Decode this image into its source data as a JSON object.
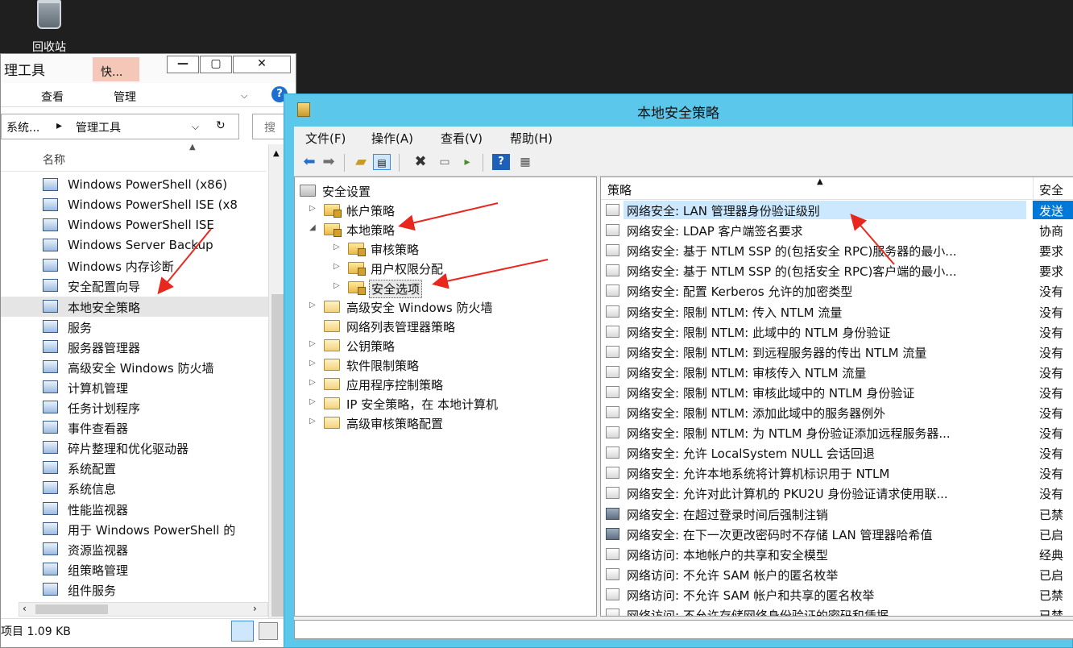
{
  "desktop": {
    "recycle_bin_label": "回收站"
  },
  "explorer": {
    "title": "理工具",
    "quick_tab": "快...",
    "min_btn": "—",
    "max_btn": "▢",
    "close_btn": "✕",
    "ribbon": {
      "view": "查看",
      "manage": "管理",
      "help": "?"
    },
    "address": {
      "root": "系统...",
      "sep": "▸",
      "current": "管理工具"
    },
    "search_placeholder": "搜",
    "column_name": "名称",
    "items": [
      "Windows PowerShell (x86)",
      "Windows PowerShell ISE (x8",
      "Windows PowerShell ISE",
      "Windows Server Backup",
      "Windows 内存诊断",
      "安全配置向导",
      "本地安全策略",
      "服务",
      "服务器管理器",
      "高级安全 Windows 防火墙",
      "计算机管理",
      "任务计划程序",
      "事件查看器",
      "碎片整理和优化驱动器",
      "系统配置",
      "系统信息",
      "性能监视器",
      "用于 Windows PowerShell 的",
      "资源监视器",
      "组策略管理",
      "组件服务"
    ],
    "selected_index": 6,
    "status": "项目 1.09 KB"
  },
  "secpol": {
    "title": "本地安全策略",
    "menu": [
      "文件(F)",
      "操作(A)",
      "查看(V)",
      "帮助(H)"
    ],
    "tree": [
      {
        "label": "安全设置",
        "level": 0,
        "arrow": "",
        "icon": "root"
      },
      {
        "label": "帐户策略",
        "level": 1,
        "arrow": "▷",
        "icon": "lock"
      },
      {
        "label": "本地策略",
        "level": 1,
        "arrow": "◢",
        "icon": "lock"
      },
      {
        "label": "审核策略",
        "level": 2,
        "arrow": "▷",
        "icon": "lock"
      },
      {
        "label": "用户权限分配",
        "level": 2,
        "arrow": "▷",
        "icon": "lock"
      },
      {
        "label": "安全选项",
        "level": 2,
        "arrow": "▷",
        "icon": "lock",
        "selected": true
      },
      {
        "label": "高级安全 Windows 防火墙",
        "level": 1,
        "arrow": "▷",
        "icon": "plain"
      },
      {
        "label": "网络列表管理器策略",
        "level": 1,
        "arrow": "",
        "icon": "plain"
      },
      {
        "label": "公钥策略",
        "level": 1,
        "arrow": "▷",
        "icon": "plain"
      },
      {
        "label": "软件限制策略",
        "level": 1,
        "arrow": "▷",
        "icon": "plain"
      },
      {
        "label": "应用程序控制策略",
        "level": 1,
        "arrow": "▷",
        "icon": "plain"
      },
      {
        "label": "IP 安全策略，在 本地计算机",
        "level": 1,
        "arrow": "▷",
        "icon": "plain"
      },
      {
        "label": "高级审核策略配置",
        "level": 1,
        "arrow": "▷",
        "icon": "plain"
      }
    ],
    "list_header": {
      "policy": "策略",
      "setting": "安全"
    },
    "rows": [
      {
        "name": "网络安全: LAN 管理器身份验证级别",
        "value": "发送",
        "selected": true
      },
      {
        "name": "网络安全: LDAP 客户端签名要求",
        "value": "协商"
      },
      {
        "name": "网络安全: 基于 NTLM SSP 的(包括安全 RPC)服务器的最小...",
        "value": "要求"
      },
      {
        "name": "网络安全: 基于 NTLM SSP 的(包括安全 RPC)客户端的最小...",
        "value": "要求"
      },
      {
        "name": "网络安全: 配置 Kerberos 允许的加密类型",
        "value": "没有"
      },
      {
        "name": "网络安全: 限制 NTLM: 传入 NTLM 流量",
        "value": "没有"
      },
      {
        "name": "网络安全: 限制 NTLM: 此域中的 NTLM 身份验证",
        "value": "没有"
      },
      {
        "name": "网络安全: 限制 NTLM: 到远程服务器的传出 NTLM 流量",
        "value": "没有"
      },
      {
        "name": "网络安全: 限制 NTLM: 审核传入 NTLM 流量",
        "value": "没有"
      },
      {
        "name": "网络安全: 限制 NTLM: 审核此域中的 NTLM 身份验证",
        "value": "没有"
      },
      {
        "name": "网络安全: 限制 NTLM: 添加此域中的服务器例外",
        "value": "没有"
      },
      {
        "name": "网络安全: 限制 NTLM: 为 NTLM 身份验证添加远程服务器...",
        "value": "没有"
      },
      {
        "name": "网络安全: 允许 LocalSystem NULL 会话回退",
        "value": "没有"
      },
      {
        "name": "网络安全: 允许本地系统将计算机标识用于 NTLM",
        "value": "没有"
      },
      {
        "name": "网络安全: 允许对此计算机的 PKU2U 身份验证请求使用联...",
        "value": "没有"
      },
      {
        "name": "网络安全: 在超过登录时间后强制注销",
        "value": "已禁",
        "icon": "alt"
      },
      {
        "name": "网络安全: 在下一次更改密码时不存储 LAN 管理器哈希值",
        "value": "已启",
        "icon": "alt"
      },
      {
        "name": "网络访问: 本地帐户的共享和安全模型",
        "value": "经典"
      },
      {
        "name": "网络访问: 不允许 SAM 帐户的匿名枚举",
        "value": "已启"
      },
      {
        "name": "网络访问: 不允许 SAM 帐户和共享的匿名枚举",
        "value": "已禁"
      },
      {
        "name": "网络访问: 不允许存储网络身份验证的密码和凭据",
        "value": "已禁"
      }
    ]
  },
  "colors": {
    "title_bar": "#5bc7ea",
    "selection": "#0078d7",
    "annotation_arrow": "#e8281e"
  }
}
